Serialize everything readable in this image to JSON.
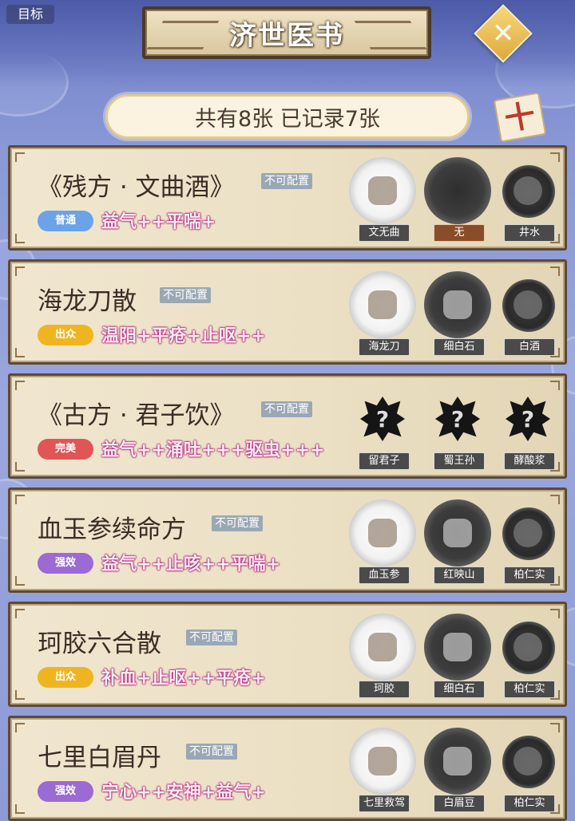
{
  "header": {
    "goal_label": "目标",
    "title": "济世医书",
    "close_glyph": "✕",
    "count_text": "共有8张 已记录7张",
    "scroll_glyph": "十"
  },
  "colors": {
    "grade_普通": "#6aa3e8",
    "grade_出众": "#efb521",
    "grade_完美": "#e05555",
    "grade_强效": "#9b6ad2",
    "effect_outline": "#a81b6e"
  },
  "recipes": [
    {
      "name": "《残方 · 文曲酒》",
      "config": "不可配置",
      "grade": "普通",
      "effects": "益气++平喘+",
      "ingredients": [
        {
          "name": "文无曲",
          "vessel": "white-plate",
          "icon": "herb-icon"
        },
        {
          "name": "无",
          "vessel": "dark-plate",
          "icon": "empty-icon",
          "empty": true
        },
        {
          "name": "井水",
          "vessel": "bowl",
          "icon": "water-icon"
        }
      ]
    },
    {
      "name": "海龙刀散",
      "config": "不可配置",
      "grade": "出众",
      "effects": "温阳+平疮+止呕++",
      "ingredients": [
        {
          "name": "海龙刀",
          "vessel": "white-plate",
          "icon": "stick-herb-icon"
        },
        {
          "name": "细白石",
          "vessel": "dark-plate",
          "icon": "stone-icon"
        },
        {
          "name": "白酒",
          "vessel": "bowl",
          "icon": "liquor-icon"
        }
      ]
    },
    {
      "name": "《古方 · 君子饮》",
      "config": "不可配置",
      "grade": "完美",
      "effects": "益气++涌吐+++驱虫+++",
      "ingredients": [
        {
          "name": "留君子",
          "vessel": "unknown",
          "icon": "mystery-icon"
        },
        {
          "name": "蜀王孙",
          "vessel": "unknown",
          "icon": "mystery-icon"
        },
        {
          "name": "酵酸浆",
          "vessel": "unknown",
          "icon": "mystery-icon"
        }
      ]
    },
    {
      "name": "血玉参续命方",
      "config": "不可配置",
      "grade": "强效",
      "effects": "益气++止咳++平喘+",
      "ingredients": [
        {
          "name": "血玉参",
          "vessel": "white-plate",
          "icon": "ginseng-icon"
        },
        {
          "name": "红映山",
          "vessel": "dark-plate",
          "icon": "herb-icon"
        },
        {
          "name": "柏仁实",
          "vessel": "bowl",
          "icon": "seed-icon"
        }
      ]
    },
    {
      "name": "珂胶六合散",
      "config": "不可配置",
      "grade": "出众",
      "effects": "补血+止呕++平疮+",
      "ingredients": [
        {
          "name": "珂胶",
          "vessel": "white-plate",
          "icon": "gelatin-icon"
        },
        {
          "name": "细白石",
          "vessel": "dark-plate",
          "icon": "stone-icon"
        },
        {
          "name": "柏仁实",
          "vessel": "bowl",
          "icon": "seed-icon"
        }
      ]
    },
    {
      "name": "七里白眉丹",
      "config": "不可配置",
      "grade": "强效",
      "effects": "宁心++安神+益气+",
      "ingredients": [
        {
          "name": "七里救驾",
          "vessel": "white-plate",
          "icon": "flower-icon"
        },
        {
          "name": "白眉豆",
          "vessel": "dark-plate",
          "icon": "bean-icon"
        },
        {
          "name": "柏仁实",
          "vessel": "bowl",
          "icon": "seed-icon"
        }
      ]
    }
  ]
}
